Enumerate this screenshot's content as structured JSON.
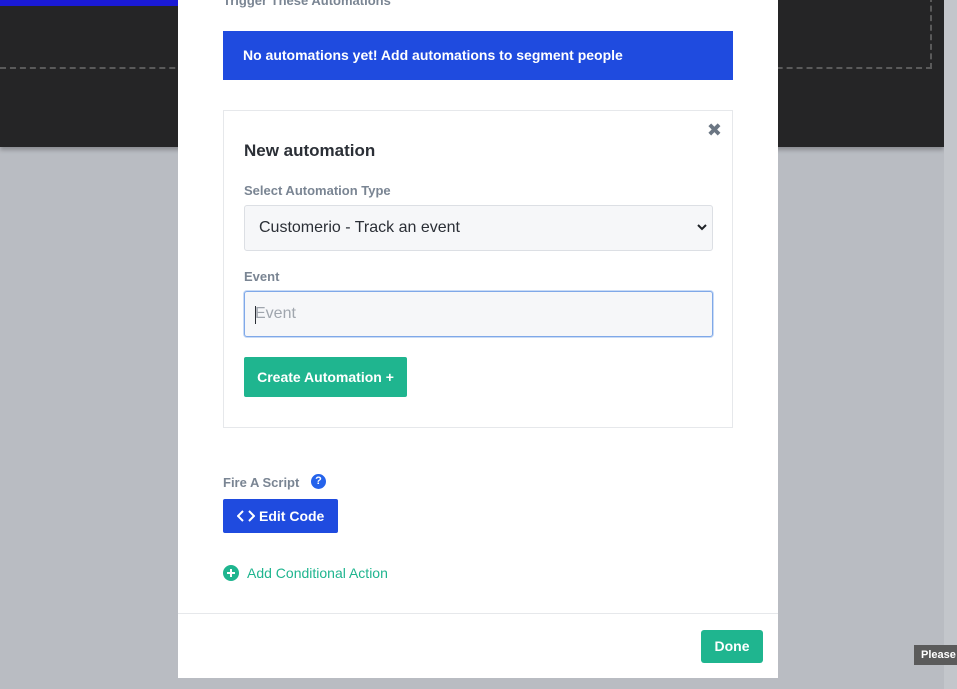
{
  "background": {
    "tooltip_text": "Please"
  },
  "modal": {
    "section_heading": "Trigger These Automations",
    "empty_banner": "No automations yet! Add automations to segment people",
    "new_automation": {
      "title": "New automation",
      "type_label": "Select Automation Type",
      "type_value": "Customerio - Track an event",
      "event_label": "Event",
      "event_placeholder": "Event",
      "event_value": "",
      "create_button": "Create Automation +"
    },
    "script": {
      "label": "Fire A Script",
      "help_icon": "question-circle-icon",
      "edit_code_button": "Edit Code",
      "edit_code_icon": "code-icon"
    },
    "add_conditional_action": "Add Conditional Action",
    "done_button": "Done"
  },
  "colors": {
    "primary_blue": "#1f4bdf",
    "accent_green": "#1fb58f",
    "muted_text": "#7a8593"
  }
}
